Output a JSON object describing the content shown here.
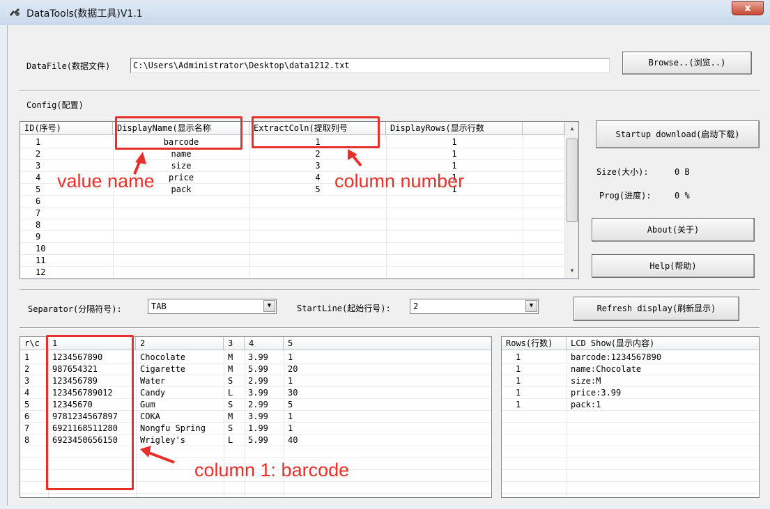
{
  "window": {
    "title": "DataTools(数据工具)V1.1",
    "close_glyph": "x"
  },
  "datafile": {
    "label": "DataFile(数据文件)",
    "path": "C:\\Users\\Administrator\\Desktop\\data1212.txt",
    "browse_label": "Browse..(浏览..)"
  },
  "config": {
    "label": "Config(配置)",
    "columns": [
      "ID(序号)",
      "DisplayName(显示名称",
      "ExtractColn(提取列号",
      "DisplayRows(显示行数"
    ],
    "rows": [
      {
        "id": "1",
        "name": "barcode",
        "coln": "1",
        "disp": "1"
      },
      {
        "id": "2",
        "name": "name",
        "coln": "2",
        "disp": "1"
      },
      {
        "id": "3",
        "name": "size",
        "coln": "3",
        "disp": "1"
      },
      {
        "id": "4",
        "name": "price",
        "coln": "4",
        "disp": "1"
      },
      {
        "id": "5",
        "name": "pack",
        "coln": "5",
        "disp": "1"
      },
      {
        "id": "6",
        "name": "",
        "coln": "",
        "disp": ""
      },
      {
        "id": "7",
        "name": "",
        "coln": "",
        "disp": ""
      },
      {
        "id": "8",
        "name": "",
        "coln": "",
        "disp": ""
      },
      {
        "id": "9",
        "name": "",
        "coln": "",
        "disp": ""
      },
      {
        "id": "10",
        "name": "",
        "coln": "",
        "disp": ""
      },
      {
        "id": "11",
        "name": "",
        "coln": "",
        "disp": ""
      },
      {
        "id": "12",
        "name": "",
        "coln": "",
        "disp": ""
      }
    ]
  },
  "side": {
    "startup_label": "Startup download(启动下载)",
    "size_label": "Size(大小):",
    "size_value": "0 B",
    "prog_label": "Prog(进度):",
    "prog_value": "0 %",
    "about_label": "About(关于)",
    "help_label": "Help(帮助)"
  },
  "options": {
    "separator_label": "Separator(分隔符号):",
    "separator_value": "TAB",
    "startline_label": "StartLine(起始行号):",
    "startline_value": "2",
    "refresh_label": "Refresh display(刷新显示)"
  },
  "data_table": {
    "columns": [
      "r\\c",
      "1",
      "2",
      "3",
      "4",
      "5"
    ],
    "rows": [
      [
        "1",
        "1234567890",
        "Chocolate",
        "M",
        "3.99",
        "1"
      ],
      [
        "2",
        "987654321",
        "Cigarette",
        "M",
        "5.99",
        "20"
      ],
      [
        "3",
        "123456789",
        "Water",
        "S",
        "2.99",
        "1"
      ],
      [
        "4",
        "123456789012",
        "Candy",
        "L",
        "3.99",
        "30"
      ],
      [
        "5",
        "12345670",
        "Gum",
        "S",
        "2.99",
        "5"
      ],
      [
        "6",
        "9781234567897",
        "COKA",
        "M",
        "3.99",
        "1"
      ],
      [
        "7",
        "6921168511280",
        "Nongfu Spring",
        "S",
        "1.99",
        "1"
      ],
      [
        "8",
        "6923450656150",
        "Wrigley's",
        "L",
        "5.99",
        "40"
      ]
    ]
  },
  "lcd_table": {
    "columns": [
      "Rows(行数)",
      "LCD Show(显示内容)"
    ],
    "rows": [
      [
        "1",
        "barcode:1234567890"
      ],
      [
        "1",
        "name:Chocolate"
      ],
      [
        "1",
        "size:M"
      ],
      [
        "1",
        "price:3.99"
      ],
      [
        "1",
        "pack:1"
      ]
    ]
  },
  "annotations": {
    "value_name": "value name",
    "column_number": "column number",
    "column_barcode": "column 1: barcode",
    "color": "#e8302a"
  }
}
